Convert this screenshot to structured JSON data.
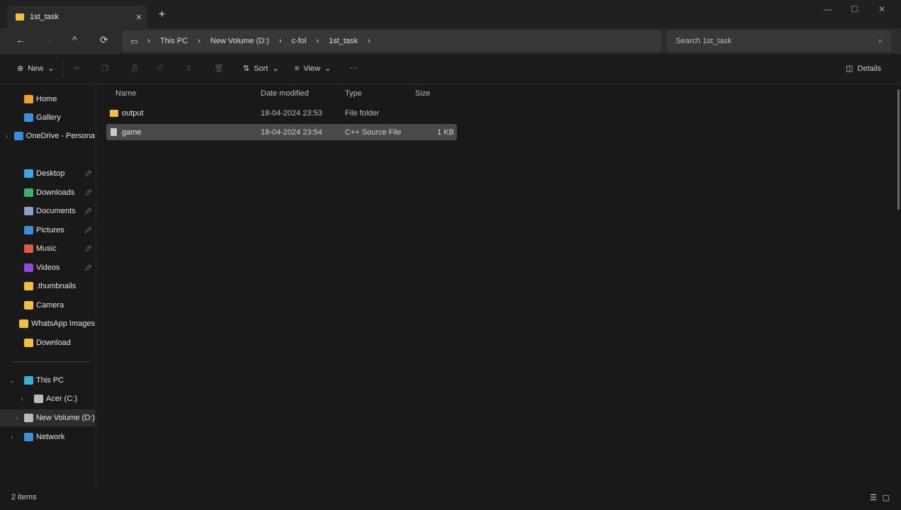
{
  "tab": {
    "title": "1st_task"
  },
  "nav": {
    "breadcrumb": [
      "This PC",
      "New Volume (D:)",
      "c-fol",
      "1st_task"
    ],
    "search_placeholder": "Search 1st_task"
  },
  "toolbar": {
    "new": "New",
    "sort": "Sort",
    "view": "View",
    "more": "···",
    "details": "Details"
  },
  "sidebar": {
    "items": [
      {
        "label": "Home",
        "color": "#f0a030"
      },
      {
        "label": "Gallery",
        "color": "#3a8fd8"
      },
      {
        "label": "OneDrive - Persona",
        "color": "#3a8fd8"
      },
      {
        "label": "Desktop",
        "color": "#3aa8e0"
      },
      {
        "label": "Downloads",
        "color": "#3ab070"
      },
      {
        "label": "Documents",
        "color": "#8aa0c0"
      },
      {
        "label": "Pictures",
        "color": "#3a8fd8"
      },
      {
        "label": "Music",
        "color": "#e05a4a"
      },
      {
        "label": "Videos",
        "color": "#8a4ae0"
      },
      {
        "label": ".thumbnails",
        "color": "#f0c040"
      },
      {
        "label": "Camera",
        "color": "#f0c040"
      },
      {
        "label": "WhatsApp Images",
        "color": "#f0c040"
      },
      {
        "label": "Download",
        "color": "#f0c040"
      },
      {
        "label": "This PC",
        "color": "#3ab0d0"
      },
      {
        "label": "Acer (C:)",
        "color": "#bbbbbb"
      },
      {
        "label": "New Volume (D:)",
        "color": "#bbbbbb"
      },
      {
        "label": "Network",
        "color": "#3a8fd8"
      }
    ]
  },
  "columns": [
    "Name",
    "Date modified",
    "Type",
    "Size"
  ],
  "files": [
    {
      "name": "output",
      "date": "18-04-2024 23:53",
      "type": "File folder",
      "size": ""
    },
    {
      "name": "game",
      "date": "18-04-2024 23:54",
      "type": "C++ Source File",
      "size": "1 KB"
    }
  ],
  "status": "2 items"
}
